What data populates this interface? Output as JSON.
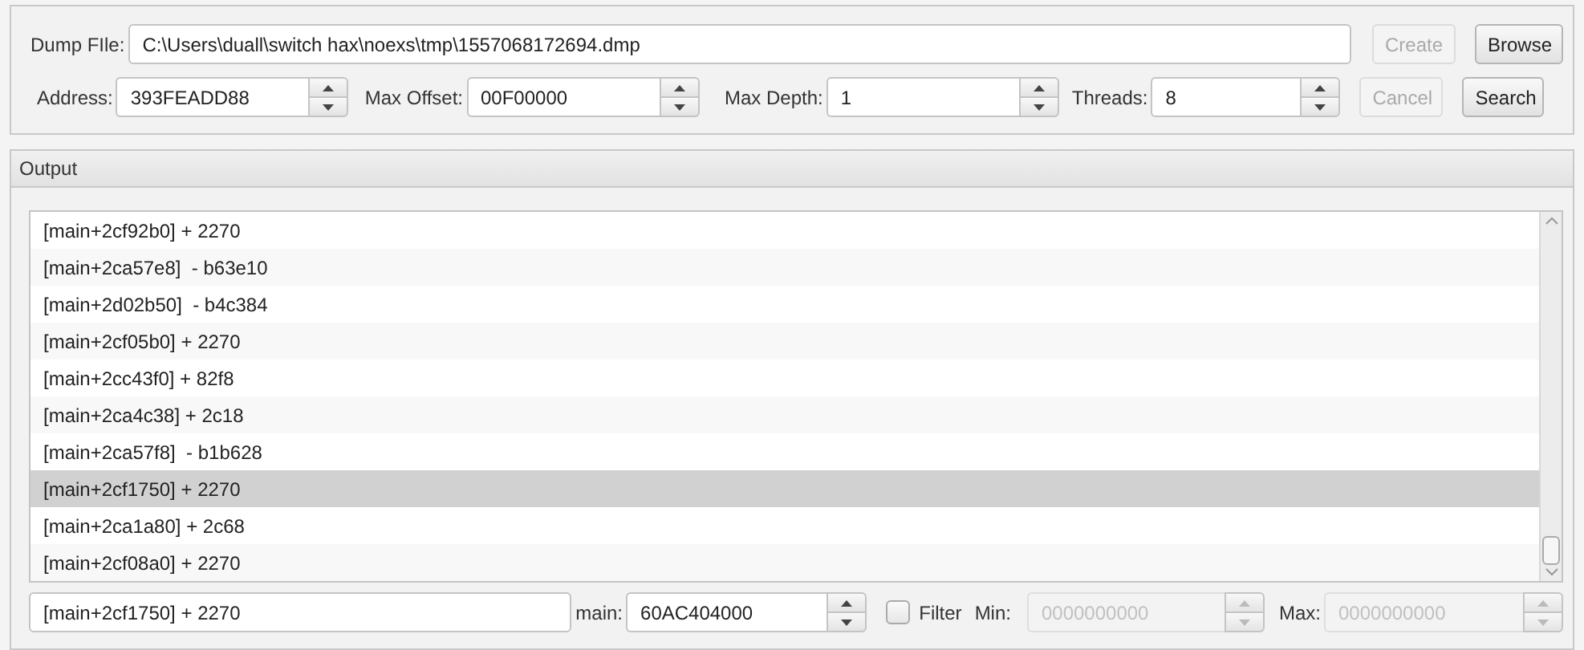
{
  "dump_file": {
    "label": "Dump FIle:",
    "value": "C:\\Users\\duall\\switch hax\\noexs\\tmp\\1557068172694.dmp"
  },
  "top_buttons": [
    {
      "label": "Create",
      "disabled": true
    },
    {
      "label": "Browse",
      "disabled": false
    }
  ],
  "params": [
    {
      "label": "Address:",
      "value": "393FEADD88"
    },
    {
      "label": "Max Offset:",
      "value": "00F00000"
    },
    {
      "label": "Max Depth:",
      "value": "1"
    },
    {
      "label": "Threads:",
      "value": "8"
    }
  ],
  "param_buttons": [
    {
      "label": "Cancel",
      "disabled": true
    },
    {
      "label": "Search",
      "disabled": false
    }
  ],
  "output": {
    "title": "Output",
    "rows": [
      {
        "text": "[main+2cf92b0] + 2270",
        "selected": false
      },
      {
        "text": "[main+2ca57e8]  - b63e10",
        "selected": false
      },
      {
        "text": "[main+2d02b50]  - b4c384",
        "selected": false
      },
      {
        "text": "[main+2cf05b0] + 2270",
        "selected": false
      },
      {
        "text": "[main+2cc43f0] + 82f8",
        "selected": false
      },
      {
        "text": "[main+2ca4c38] + 2c18",
        "selected": false
      },
      {
        "text": "[main+2ca57f8]  - b1b628",
        "selected": false
      },
      {
        "text": "[main+2cf1750] + 2270",
        "selected": true
      },
      {
        "text": "[main+2ca1a80] + 2c68",
        "selected": false
      },
      {
        "text": "[main+2cf08a0] + 2270",
        "selected": false
      }
    ]
  },
  "bottom": {
    "expression": "[main+2cf1750] + 2270",
    "main": {
      "label": "main:",
      "value": "60AC404000"
    },
    "filter": {
      "label": "Filter",
      "checked": false
    },
    "min": {
      "label": "Min:",
      "placeholder": "0000000000",
      "disabled": true
    },
    "max": {
      "label": "Max:",
      "placeholder": "0000000000",
      "disabled": true
    }
  }
}
